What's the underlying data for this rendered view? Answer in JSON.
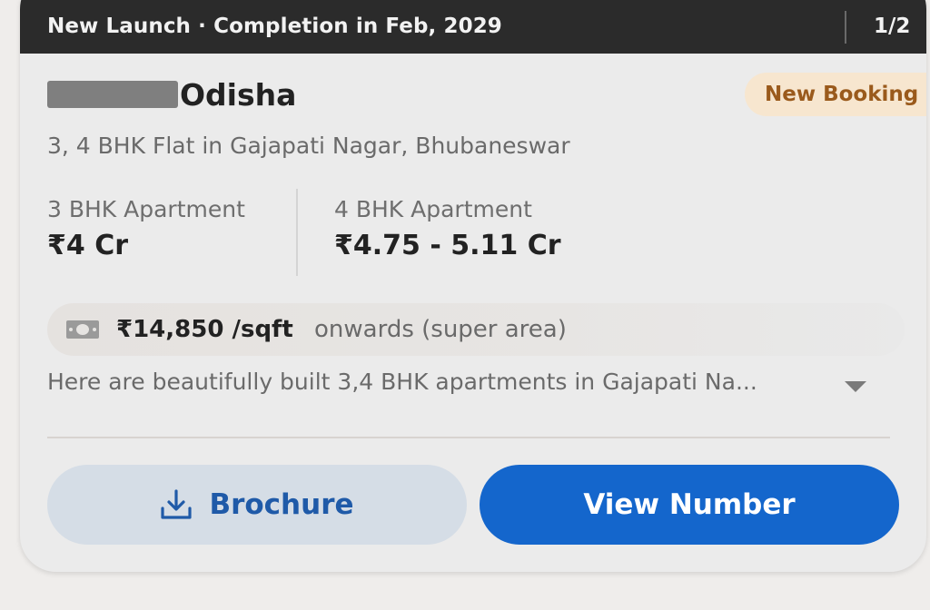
{
  "header": {
    "status_text": "New Launch · Completion in Feb, 2029",
    "counter": "1/2"
  },
  "listing": {
    "title": "Odisha",
    "badge": "New Booking",
    "subtitle": "3, 4 BHK Flat in Gajapati Nagar, Bhubaneswar",
    "configs": [
      {
        "label": "3 BHK Apartment",
        "price": "₹4 Cr"
      },
      {
        "label": "4 BHK Apartment",
        "price": "₹4.75 - 5.11 Cr"
      }
    ],
    "rate": {
      "value": "₹14,850 /sqft",
      "suffix": "onwards (super area)",
      "icon": "money-icon"
    },
    "description": "Here are beautifully built 3,4 BHK apartments in Gajapati Na...",
    "expand_icon": "chevron-down-icon"
  },
  "actions": {
    "brochure_label": "Brochure",
    "brochure_icon": "download-icon",
    "view_number_label": "View Number"
  },
  "colors": {
    "header_bg": "#2b2b2b",
    "badge_bg": "#f7e6cf",
    "badge_text": "#9a5a1c",
    "primary_button": "#1466cc",
    "secondary_button_bg": "#d5dde6",
    "secondary_button_text": "#1f5aa8"
  }
}
